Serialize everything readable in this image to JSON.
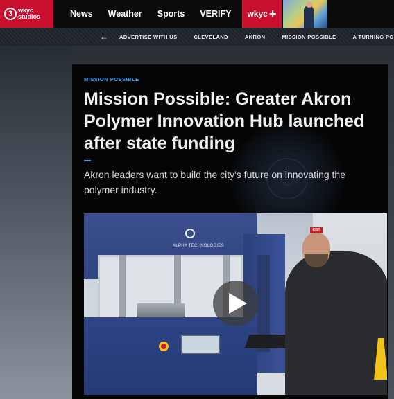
{
  "header": {
    "logo": {
      "channel_number": "3",
      "line1": "wkyc",
      "line2": "studios",
      "brand_color": "#c8102e"
    },
    "nav_items": [
      "News",
      "Weather",
      "Sports",
      "VERIFY"
    ],
    "plus_label": "wkyc",
    "weather_thumbnail": "weather-map-thumbnail"
  },
  "subnav": {
    "back_icon": "arrow-left-icon",
    "items": [
      "ADVERTISE WITH US",
      "CLEVELAND",
      "AKRON",
      "MISSION POSSIBLE",
      "A TURNING POINT"
    ]
  },
  "article": {
    "kicker": "MISSION POSSIBLE",
    "headline": "Mission Possible: Greater Akron Polymer Innovation Hub launched after state funding",
    "dek": "Akron leaders want to build the city's future on innovating the polymer industry.",
    "accent_color": "#3aa4ff"
  },
  "video": {
    "play_icon": "play-icon",
    "machine_label": "ALPHA TECHNOLOGIES",
    "exit_sign": "EXIT"
  }
}
